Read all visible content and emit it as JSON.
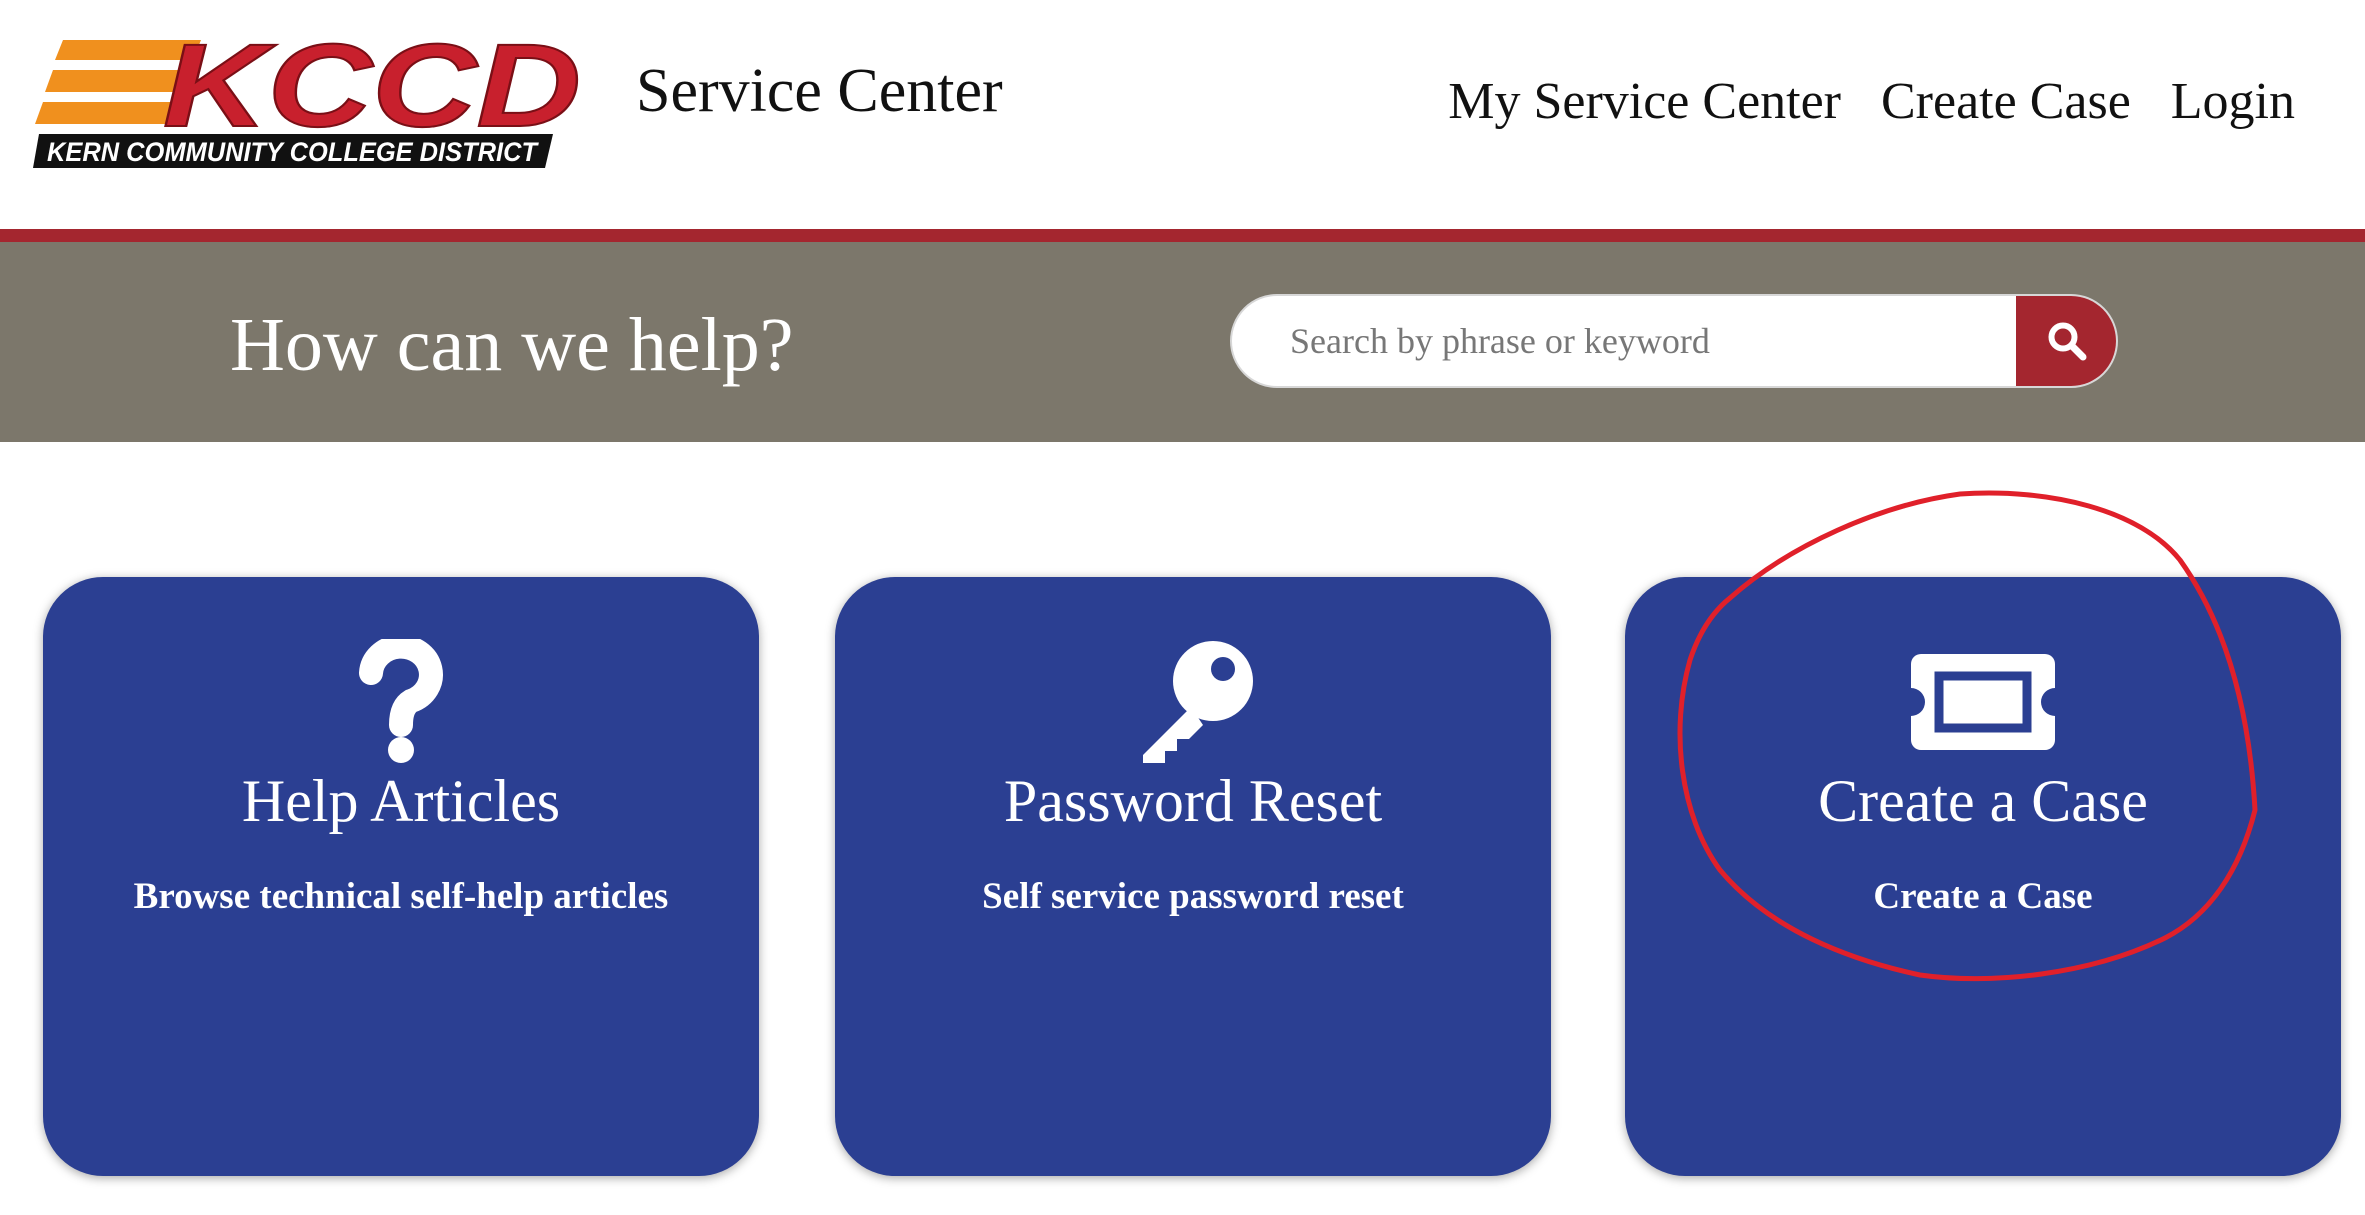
{
  "header": {
    "logo": {
      "wordmark": "KCCD",
      "tagline": "KERN COMMUNITY COLLEGE DISTRICT"
    },
    "site_title": "Service Center",
    "nav": [
      "My Service Center",
      "Create Case",
      "Login"
    ]
  },
  "hero": {
    "title": "How can we help?",
    "search": {
      "placeholder": "Search by phrase or keyword",
      "button_icon": "search-icon"
    }
  },
  "tiles": [
    {
      "icon": "question-mark-icon",
      "title": "Help Articles",
      "subtitle": "Browse technical self-help articles"
    },
    {
      "icon": "key-icon",
      "title": "Password Reset",
      "subtitle": "Self service password reset"
    },
    {
      "icon": "ticket-icon",
      "title": "Create a Case",
      "subtitle": "Create a Case"
    }
  ],
  "colors": {
    "accent_red": "#a4262f",
    "hero_gray": "#7c776b",
    "tile_blue": "#2b3f92",
    "logo_orange": "#f0901e",
    "logo_red": "#c8202d",
    "annotation_red": "#e0202a"
  }
}
